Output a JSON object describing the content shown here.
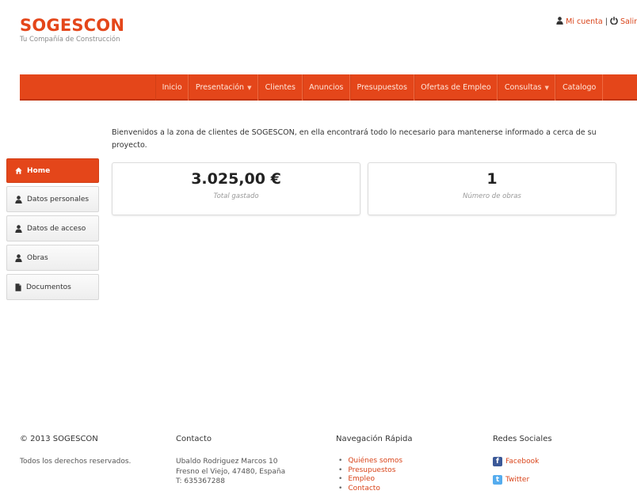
{
  "brand": {
    "name": "SOGESCON",
    "tagline": "Tu Compañía de Construcción"
  },
  "top_links": {
    "account": "Mi cuenta",
    "separator": "|",
    "logout": "Salir"
  },
  "nav": {
    "items": [
      {
        "label": "Inicio"
      },
      {
        "label": "Presentación",
        "caret": "▼"
      },
      {
        "label": "Clientes"
      },
      {
        "label": "Anuncios"
      },
      {
        "label": "Presupuestos"
      },
      {
        "label": "Ofertas de Empleo"
      },
      {
        "label": "Consultas",
        "caret": "▼"
      },
      {
        "label": "Catalogo"
      }
    ]
  },
  "welcome_text": "Bienvenidos a la zona de clientes de SOGESCON, en ella encontrará todo lo necesario para mantenerse informado a cerca de su proyecto.",
  "sidebar": {
    "items": [
      {
        "label": "Home",
        "icon": "home-icon"
      },
      {
        "label": "Datos personales",
        "icon": "user-icon"
      },
      {
        "label": "Datos de acceso",
        "icon": "user-icon"
      },
      {
        "label": "Obras",
        "icon": "user-icon"
      },
      {
        "label": "Documentos",
        "icon": "document-icon"
      }
    ]
  },
  "stats": {
    "spent": {
      "value": "3.025,00 €",
      "label": "Total gastado"
    },
    "works": {
      "value": "1",
      "label": "Número de obras"
    }
  },
  "footer": {
    "copyright": "© 2013 SOGESCON",
    "rights": "Todos los derechos reservados.",
    "contact_title": "Contacto",
    "contact_lines": [
      "Ubaldo Rodriguez Marcos 10",
      "Fresno el Viejo, 47480, España",
      "T: 635367288"
    ],
    "nav_title": "Navegación Rápida",
    "nav_links": [
      "Quiénes somos",
      "Presupuestos",
      "Empleo",
      "Contacto"
    ],
    "social_title": "Redes Sociales",
    "facebook": "Facebook",
    "twitter": "Twitter"
  },
  "colors": {
    "accent": "#e4461a",
    "link": "#d9441a",
    "facebook": "#3b5998",
    "twitter": "#55acee"
  }
}
